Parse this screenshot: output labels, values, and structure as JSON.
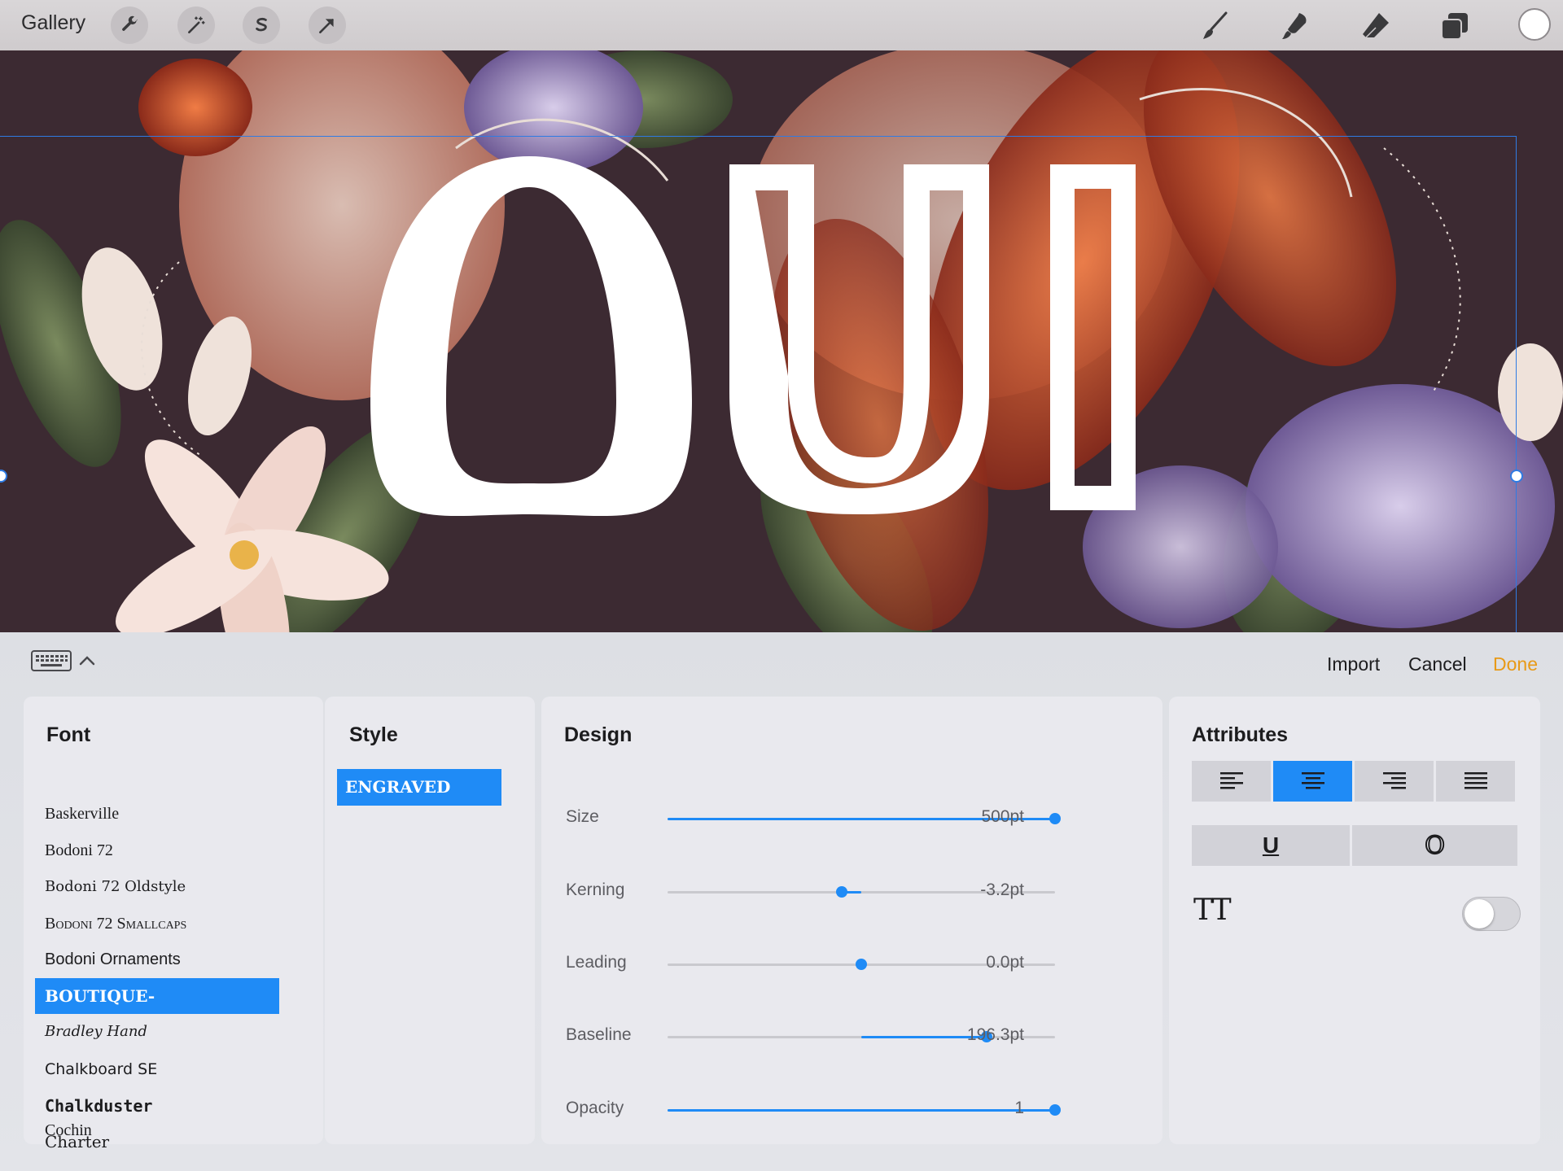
{
  "toolbar": {
    "gallery_label": "Gallery",
    "left_tools": [
      "wrench-icon",
      "magic-wand-icon",
      "selection-s-icon",
      "transform-arrow-icon"
    ],
    "right_tools": [
      "brush-icon",
      "smudge-icon",
      "eraser-icon",
      "layers-icon"
    ],
    "current_color": "#ffffff"
  },
  "canvas": {
    "text": "OUI",
    "accent": "#2f7be3"
  },
  "panel": {
    "actions": {
      "import": "Import",
      "cancel": "Cancel",
      "done": "Done"
    },
    "font": {
      "title": "Font",
      "items": [
        "Baskerville",
        "Bodoni 72",
        "Bodoni 72 Oldstyle",
        "Bodoni 72 Smallcaps",
        "Bodoni Ornaments",
        "BOUTIQUE-",
        "Bradley Hand",
        "Chalkboard SE",
        "Chalkduster",
        "Charter",
        "Cochin"
      ],
      "selected_index": 5
    },
    "style": {
      "title": "Style",
      "items": [
        "ENGRAVED"
      ]
    },
    "design": {
      "title": "Design",
      "sliders": [
        {
          "label": "Size",
          "value": "500pt",
          "fraction": 1.0
        },
        {
          "label": "Kerning",
          "value": "-3.2pt",
          "fraction": 0.45
        },
        {
          "label": "Leading",
          "value": "0.0pt",
          "fraction": 0.5
        },
        {
          "label": "Baseline",
          "value": "196.3pt",
          "fraction": 0.83
        },
        {
          "label": "Opacity",
          "value": "1",
          "fraction": 1.0
        }
      ]
    },
    "attributes": {
      "title": "Attributes",
      "alignments": [
        "align-left-icon",
        "align-center-icon",
        "align-right-icon",
        "align-justify-icon"
      ],
      "selected_alignment": 1,
      "underline_label": "U",
      "outline_label": "O",
      "all_caps_label": "TT",
      "all_caps_on": false
    },
    "accent": "#1f8bf6"
  }
}
